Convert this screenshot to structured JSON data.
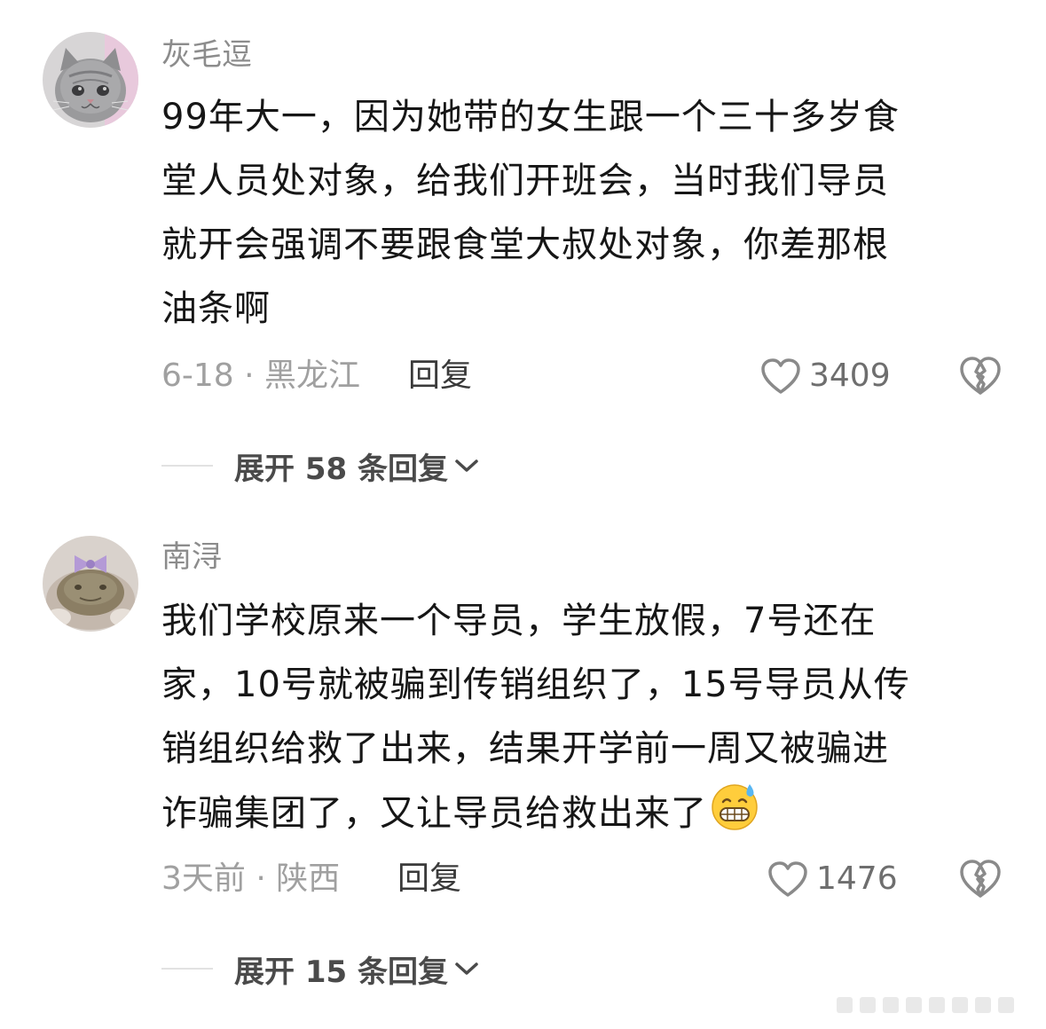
{
  "comments": [
    {
      "username": "灰毛逗",
      "avatar_icon": "gray-cat-avatar",
      "content_lines": [
        "99年大一，因为她带的女生跟一个三十多岁食",
        "堂人员处对象，给我们开班会，当时我们导员",
        "就开会强调不要跟食堂大叔处对象，你差那根",
        "油条啊"
      ],
      "date": "6-18",
      "location": "黑龙江",
      "meta_text": "6-18 · 黑龙江",
      "reply_label": "回复",
      "likes": "3409",
      "expand_label": "展开 58 条回复"
    },
    {
      "username": "南浔",
      "avatar_icon": "frog-with-bow-avatar",
      "content_lines": [
        "我们学校原来一个导员，学生放假，7号还在",
        "家，10号就被骗到传销组织了，15号导员从传",
        "销组织给救了出来，结果开学前一周又被骗进",
        "诈骗集团了，又让导员给救出来了"
      ],
      "emoji": "grinning-sweat-emoji",
      "date": "3天前",
      "location": "陕西",
      "meta_text": "3天前 · 陕西",
      "reply_label": "回复",
      "likes": "1476",
      "expand_label": "展开 15 条回复"
    }
  ],
  "icons": {
    "like": "heart-outline-icon",
    "dislike": "broken-heart-icon",
    "expand": "chevron-down-icon"
  },
  "colors": {
    "username": "#8c8c8c",
    "content": "#161616",
    "meta": "#a0a0a0",
    "reply": "#3a3a3a",
    "like_count": "#6e6e6e"
  }
}
